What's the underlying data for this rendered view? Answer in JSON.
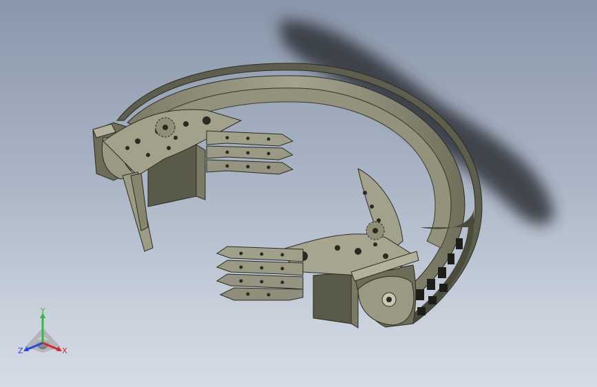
{
  "viewport": {
    "background_top": "#8a97ab",
    "background_bottom": "#d6dce6"
  },
  "model": {
    "body_color": "#8c8c76",
    "shadow_color": "#2e3238",
    "parts": [
      "ring",
      "gripper-left",
      "gripper-right",
      "fingers-left",
      "fingers-right"
    ]
  },
  "triad": {
    "y_label": "Y",
    "x_label": "X",
    "z_label": "Z",
    "y_color": "#2fbf3f",
    "x_color": "#d8262a",
    "z_color": "#2a46d8"
  }
}
